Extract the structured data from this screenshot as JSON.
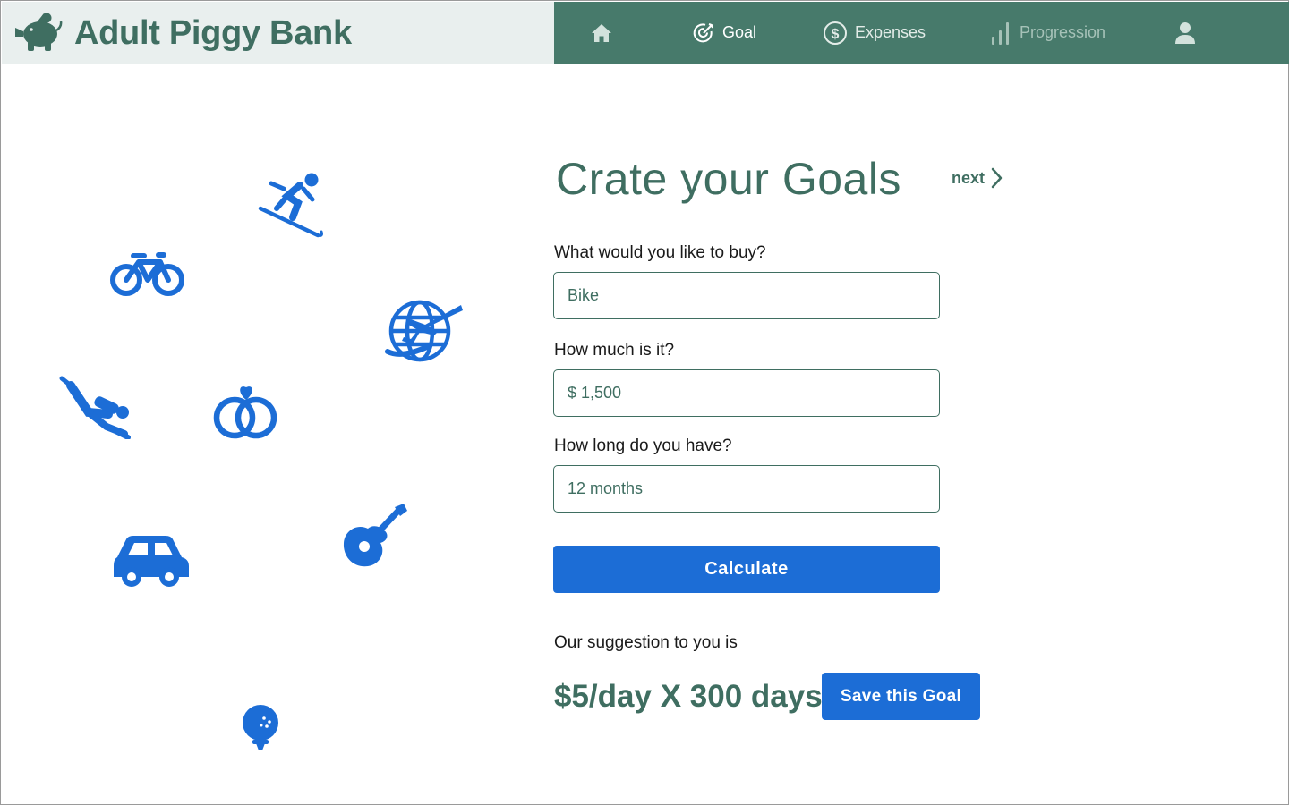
{
  "brand": {
    "title": "Adult Piggy Bank",
    "logo_icon": "piggy-bank-icon"
  },
  "nav": {
    "items": [
      {
        "key": "home",
        "label": "",
        "icon": "home-icon",
        "active": false
      },
      {
        "key": "goal",
        "label": "Goal",
        "icon": "target-icon",
        "active": true
      },
      {
        "key": "expenses",
        "label": "Expenses",
        "icon": "dollar-circle-icon",
        "active": false
      },
      {
        "key": "progression",
        "label": "Progression",
        "icon": "bar-chart-icon",
        "active": false
      },
      {
        "key": "profile",
        "label": "",
        "icon": "user-icon",
        "active": false
      }
    ]
  },
  "goal_icons": [
    "skiing-icon",
    "bicycle-icon",
    "travel-globe-icon",
    "scuba-diving-icon",
    "wedding-rings-icon",
    "car-icon",
    "guitar-icon",
    "golf-ball-icon"
  ],
  "form": {
    "title": "Crate your Goals",
    "next_label": "next",
    "fields": [
      {
        "label": "What would you like to buy?",
        "value": "Bike"
      },
      {
        "label": "How much is it?",
        "value": "$ 1,500"
      },
      {
        "label": "How long do you have?",
        "value": "12 months"
      }
    ],
    "calculate_label": "Calculate"
  },
  "suggestion": {
    "label": "Our suggestion to you is",
    "value": "$5/day X 300 days",
    "save_label": "Save this Goal"
  },
  "colors": {
    "brand_green": "#3f6e61",
    "nav_green": "#477a6b",
    "brand_bar_bg": "#e9efee",
    "accent_blue": "#1c6dd6"
  }
}
